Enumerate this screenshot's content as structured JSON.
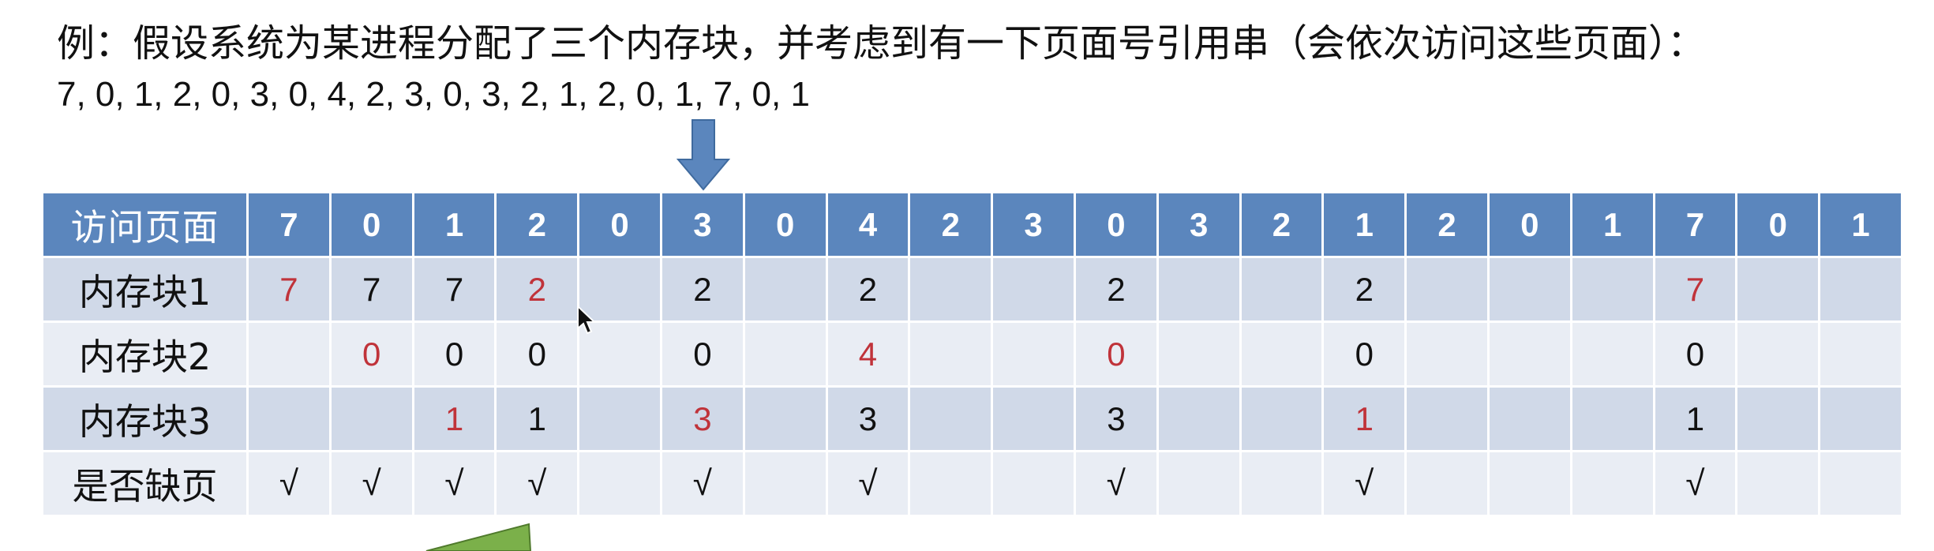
{
  "intro_text": "例：假设系统为某进程分配了三个内存块，并考虑到有一下页面号引用串（会依次访问这些页面）：",
  "sequence_text": "7, 0, 1, 2, 0, 3, 0, 4, 2, 3, 0, 3, 2, 1, 2, 0, 1, 7, 0, 1",
  "colors": {
    "header_bg": "#5b86bd",
    "row_dark": "#d0d9e8",
    "row_light": "#e9edf4",
    "highlight": "#c0333a",
    "arrow": "#5b86bd",
    "green_shape": "#7bb04a"
  },
  "icons": {
    "pointer_arrow": "down-arrow-icon",
    "cursor": "mouse-cursor-icon"
  },
  "table": {
    "header_label": "访问页面",
    "pages": [
      "7",
      "0",
      "1",
      "2",
      "0",
      "3",
      "0",
      "4",
      "2",
      "3",
      "0",
      "3",
      "2",
      "1",
      "2",
      "0",
      "1",
      "7",
      "0",
      "1"
    ],
    "rows": [
      {
        "label": "内存块1",
        "cells": [
          {
            "v": "7",
            "new": true
          },
          {
            "v": "7",
            "new": false
          },
          {
            "v": "7",
            "new": false
          },
          {
            "v": "2",
            "new": true
          },
          {
            "v": "",
            "new": false
          },
          {
            "v": "2",
            "new": false
          },
          {
            "v": "",
            "new": false
          },
          {
            "v": "2",
            "new": false
          },
          {
            "v": "",
            "new": false
          },
          {
            "v": "",
            "new": false
          },
          {
            "v": "2",
            "new": false
          },
          {
            "v": "",
            "new": false
          },
          {
            "v": "",
            "new": false
          },
          {
            "v": "2",
            "new": false
          },
          {
            "v": "",
            "new": false
          },
          {
            "v": "",
            "new": false
          },
          {
            "v": "",
            "new": false
          },
          {
            "v": "7",
            "new": true
          },
          {
            "v": "",
            "new": false
          },
          {
            "v": "",
            "new": false
          }
        ]
      },
      {
        "label": "内存块2",
        "cells": [
          {
            "v": "",
            "new": false
          },
          {
            "v": "0",
            "new": true
          },
          {
            "v": "0",
            "new": false
          },
          {
            "v": "0",
            "new": false
          },
          {
            "v": "",
            "new": false
          },
          {
            "v": "0",
            "new": false
          },
          {
            "v": "",
            "new": false
          },
          {
            "v": "4",
            "new": true
          },
          {
            "v": "",
            "new": false
          },
          {
            "v": "",
            "new": false
          },
          {
            "v": "0",
            "new": true
          },
          {
            "v": "",
            "new": false
          },
          {
            "v": "",
            "new": false
          },
          {
            "v": "0",
            "new": false
          },
          {
            "v": "",
            "new": false
          },
          {
            "v": "",
            "new": false
          },
          {
            "v": "",
            "new": false
          },
          {
            "v": "0",
            "new": false
          },
          {
            "v": "",
            "new": false
          },
          {
            "v": "",
            "new": false
          }
        ]
      },
      {
        "label": "内存块3",
        "cells": [
          {
            "v": "",
            "new": false
          },
          {
            "v": "",
            "new": false
          },
          {
            "v": "1",
            "new": true
          },
          {
            "v": "1",
            "new": false
          },
          {
            "v": "",
            "new": false
          },
          {
            "v": "3",
            "new": true
          },
          {
            "v": "",
            "new": false
          },
          {
            "v": "3",
            "new": false
          },
          {
            "v": "",
            "new": false
          },
          {
            "v": "",
            "new": false
          },
          {
            "v": "3",
            "new": false
          },
          {
            "v": "",
            "new": false
          },
          {
            "v": "",
            "new": false
          },
          {
            "v": "1",
            "new": true
          },
          {
            "v": "",
            "new": false
          },
          {
            "v": "",
            "new": false
          },
          {
            "v": "",
            "new": false
          },
          {
            "v": "1",
            "new": false
          },
          {
            "v": "",
            "new": false
          },
          {
            "v": "",
            "new": false
          }
        ]
      }
    ],
    "fault_row": {
      "label": "是否缺页",
      "cells": [
        "√",
        "√",
        "√",
        "√",
        "",
        "√",
        "",
        "√",
        "",
        "",
        "√",
        "",
        "",
        "√",
        "",
        "",
        "",
        "√",
        "",
        ""
      ]
    }
  }
}
